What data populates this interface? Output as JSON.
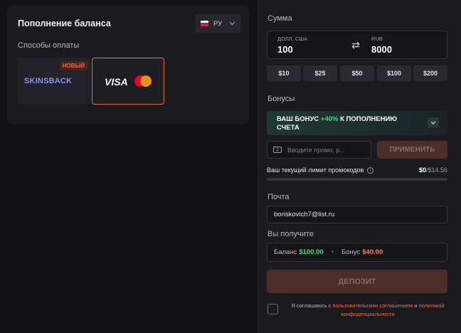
{
  "left": {
    "title": "Пополнение баланса",
    "lang": {
      "code": "РУ"
    },
    "methods_label": "Способы оплаты",
    "methods": [
      {
        "name": "SKINSBACK",
        "badge": "НОВЫЙ"
      },
      {
        "name": "VISA"
      }
    ]
  },
  "amount": {
    "label": "Сумма",
    "from_currency": "ДОЛЛ. США",
    "from_value": "100",
    "to_currency": "RUB",
    "to_value": "8000",
    "quick": [
      "$10",
      "$25",
      "$50",
      "$100",
      "$200"
    ]
  },
  "bonuses": {
    "label": "Бонусы",
    "banner_prefix": "ВАШ БОНУС ",
    "banner_pct": "+40%",
    "banner_suffix": " К ПОПОЛНЕНИЮ СЧЕТА",
    "promo_placeholder": "Вводите промо, р...",
    "apply_label": "ПРИМЕНИТЬ",
    "limit_label": "Ваш текущий лимит промокодов",
    "limit_used": "$0",
    "limit_max": "/$14.56",
    "limit_fraction": 0
  },
  "email": {
    "label": "Почта",
    "value": "boriskovich7@list.ru"
  },
  "receive": {
    "label": "Вы получите",
    "balance_label": "Баланс",
    "balance_value": "$100.00",
    "bonus_label": "Бонус",
    "bonus_value": "$40.00"
  },
  "deposit_label": "ДЕПОЗИТ",
  "agreement": {
    "prefix": "Я соглашаюсь с ",
    "terms": "пользовательским соглашением",
    "and": " и ",
    "privacy": "политикой конфиденциальности"
  },
  "colors": {
    "accent": "#ff6a3d",
    "bonus_green": "#3ce07a",
    "background": "#121216"
  }
}
